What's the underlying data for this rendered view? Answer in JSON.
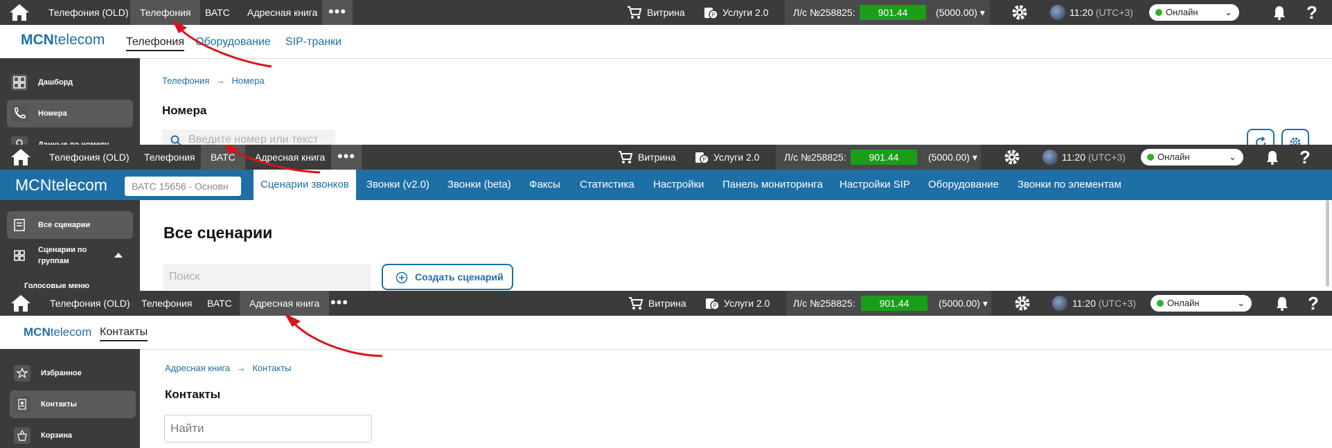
{
  "topbar": {
    "items": [
      "Телефония (OLD)",
      "Телефония",
      "ВАТС",
      "Адресная книга"
    ],
    "more_label": "•••",
    "showcase": "Витрина",
    "services": "Услуги 2.0",
    "account": "Л/с №258825:",
    "balance": "901.44",
    "credit": "(5000.00)",
    "time": "11:20",
    "timezone": "(UTC+3)",
    "status": "Онлайн",
    "colors": {
      "bar": "#3b3b3b",
      "active": "#555555",
      "balance": "#1a9e1a",
      "online": "#29b32b"
    }
  },
  "brand": {
    "logo_bold": "MCN",
    "logo_rest": "telecom",
    "color": "#1d6fa5"
  },
  "panel1": {
    "subnav": [
      "Телефония",
      "Оборудование",
      "SIP-транки"
    ],
    "sidebar": [
      "Дашборд",
      "Номера",
      "Данные по номеру"
    ],
    "breadcrumb": [
      "Телефония",
      "Номера"
    ],
    "title": "Номера",
    "search_placeholder": "Введите номер или текст"
  },
  "panel2": {
    "vatc_select": "ВАТС 15656 - Основн",
    "tabs": [
      "Сценарии звонков",
      "Звонки (v2.0)",
      "Звонки (beta)",
      "Факсы",
      "Статистика",
      "Настройки",
      "Панель мониторинга",
      "Настройки SIP",
      "Оборудование",
      "Звонки по элементам"
    ],
    "sidebar": [
      "Все сценарии",
      "Сценарии по",
      "группам",
      "Голосовые меню"
    ],
    "title": "Все сценарии",
    "search_placeholder": "Поиск",
    "create_button": "Создать сценарий"
  },
  "panel3": {
    "subnav": [
      "Контакты"
    ],
    "sidebar": [
      "Избранное",
      "Контакты",
      "Корзина"
    ],
    "breadcrumb": [
      "Адресная книга",
      "Контакты"
    ],
    "title": "Контакты",
    "search_placeholder": "Найти"
  }
}
